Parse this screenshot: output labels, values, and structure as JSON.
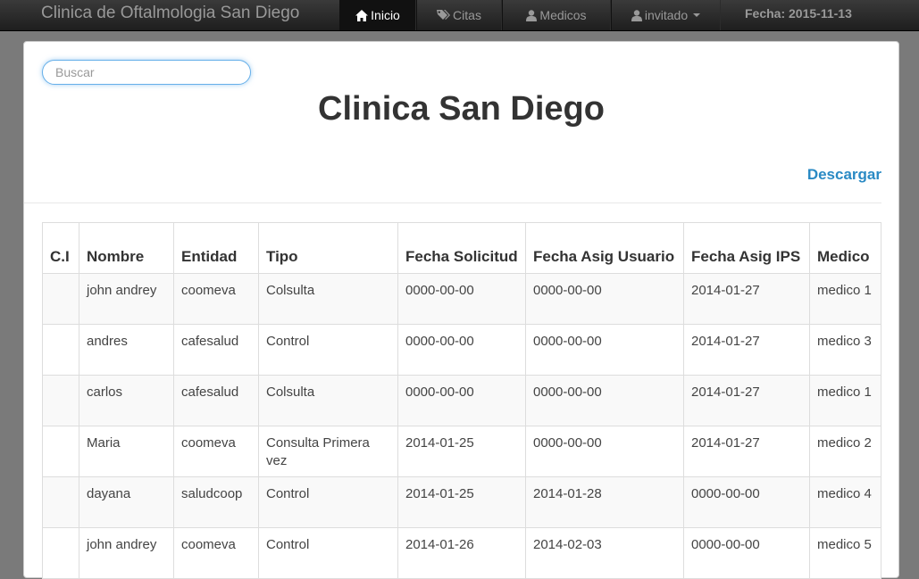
{
  "navbar": {
    "brand": "Clinica de Oftalmologia San Diego",
    "items": [
      {
        "label": "Inicio",
        "icon": "home-icon"
      },
      {
        "label": "Citas",
        "icon": "tags-icon"
      },
      {
        "label": "Medicos",
        "icon": "user-icon"
      },
      {
        "label": "invitado",
        "icon": "user-icon"
      }
    ],
    "fecha": "Fecha: 2015-11-13"
  },
  "search": {
    "placeholder": "Buscar",
    "value": ""
  },
  "page": {
    "title": "Clinica San Diego",
    "download_label": "Descargar"
  },
  "table": {
    "headers": [
      "C.I",
      "Nombre",
      "Entidad",
      "Tipo",
      "Fecha Solicitud",
      "Fecha Asig Usuario",
      "Fecha Asig IPS",
      "Medico"
    ],
    "rows": [
      [
        "",
        "john andrey",
        "coomeva",
        "Colsulta",
        "0000-00-00",
        "0000-00-00",
        "2014-01-27",
        "medico 1"
      ],
      [
        "",
        "andres",
        "cafesalud",
        "Control",
        "0000-00-00",
        "0000-00-00",
        "2014-01-27",
        "medico 3"
      ],
      [
        "",
        "carlos",
        "cafesalud",
        "Colsulta",
        "0000-00-00",
        "0000-00-00",
        "2014-01-27",
        "medico 1"
      ],
      [
        "",
        "Maria",
        "coomeva",
        "Consulta Primera vez",
        "2014-01-25",
        "0000-00-00",
        "2014-01-27",
        "medico 2"
      ],
      [
        "",
        "dayana",
        "saludcoop",
        "Control",
        "2014-01-25",
        "2014-01-28",
        "0000-00-00",
        "medico 4"
      ],
      [
        "",
        "john andrey",
        "coomeva",
        "Control",
        "2014-01-26",
        "2014-02-03",
        "0000-00-00",
        "medico 5"
      ]
    ]
  },
  "colors": {
    "navbar_bg": "#222222",
    "link": "#2a8ac4",
    "focus": "#66afe9"
  }
}
